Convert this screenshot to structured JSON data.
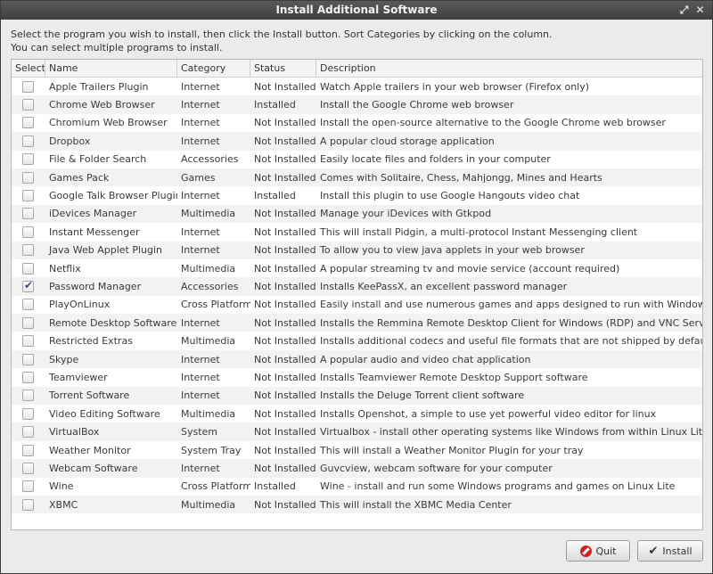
{
  "window": {
    "title": "Install Additional Software",
    "maximize_icon": "maximize-icon",
    "close_icon": "close-icon"
  },
  "instructions": {
    "line1": "Select the program you wish to install, then click the Install button. Sort Categories by clicking on the column.",
    "line2": "You can select multiple programs to install."
  },
  "table": {
    "headers": {
      "select": "Select",
      "name": "Name",
      "category": "Category",
      "status": "Status",
      "description": "Description"
    },
    "rows": [
      {
        "checked": false,
        "name": "Apple Trailers Plugin",
        "category": "Internet",
        "status": "Not Installed",
        "description": "Watch Apple trailers in your web browser (Firefox only)"
      },
      {
        "checked": false,
        "name": "Chrome Web Browser",
        "category": "Internet",
        "status": "Installed",
        "description": "Install the Google Chrome web browser"
      },
      {
        "checked": false,
        "name": "Chromium Web Browser",
        "category": "Internet",
        "status": "Not Installed",
        "description": "Install the open-source alternative to the Google Chrome web browser"
      },
      {
        "checked": false,
        "name": "Dropbox",
        "category": "Internet",
        "status": "Not Installed",
        "description": "A popular cloud storage application"
      },
      {
        "checked": false,
        "name": "File & Folder Search",
        "category": "Accessories",
        "status": "Not Installed",
        "description": "Easily locate files and folders in your computer"
      },
      {
        "checked": false,
        "name": "Games Pack",
        "category": "Games",
        "status": "Not Installed",
        "description": "Comes with Solitaire, Chess, Mahjongg, Mines and Hearts"
      },
      {
        "checked": false,
        "name": "Google Talk Browser Plugin",
        "category": "Internet",
        "status": "Installed",
        "description": "Install this plugin to use Google Hangouts video chat"
      },
      {
        "checked": false,
        "name": "iDevices Manager",
        "category": "Multimedia",
        "status": "Not Installed",
        "description": "Manage your iDevices with Gtkpod"
      },
      {
        "checked": false,
        "name": "Instant Messenger",
        "category": "Internet",
        "status": "Not Installed",
        "description": "This will install Pidgin, a multi-protocol Instant Messenging client"
      },
      {
        "checked": false,
        "name": "Java Web Applet Plugin",
        "category": "Internet",
        "status": "Not Installed",
        "description": "To allow you to view java applets in your web browser"
      },
      {
        "checked": false,
        "name": "Netflix",
        "category": "Multimedia",
        "status": "Not Installed",
        "description": "A popular streaming tv and movie service (account required)"
      },
      {
        "checked": true,
        "name": "Password Manager",
        "category": "Accessories",
        "status": "Not Installed",
        "description": "Installs KeePassX, an excellent password manager"
      },
      {
        "checked": false,
        "name": "PlayOnLinux",
        "category": "Cross Platform",
        "status": "Not Installed",
        "description": "Easily install and use numerous games and apps designed to run with Windows"
      },
      {
        "checked": false,
        "name": "Remote Desktop Software",
        "category": "Internet",
        "status": "Not Installed",
        "description": "Installs the Remmina Remote Desktop Client for Windows (RDP) and VNC Servers"
      },
      {
        "checked": false,
        "name": "Restricted Extras",
        "category": "Multimedia",
        "status": "Not Installed",
        "description": "Installs additional codecs and useful file formats that are not shipped by default"
      },
      {
        "checked": false,
        "name": "Skype",
        "category": "Internet",
        "status": "Not Installed",
        "description": "A popular audio and video chat application"
      },
      {
        "checked": false,
        "name": "Teamviewer",
        "category": "Internet",
        "status": "Not Installed",
        "description": "Installs Teamviewer Remote Desktop Support software"
      },
      {
        "checked": false,
        "name": "Torrent Software",
        "category": "Internet",
        "status": "Not Installed",
        "description": "Installs the Deluge Torrent client software"
      },
      {
        "checked": false,
        "name": "Video Editing Software",
        "category": "Multimedia",
        "status": "Not Installed",
        "description": "Installs Openshot, a simple to use yet powerful video editor for linux"
      },
      {
        "checked": false,
        "name": "VirtualBox",
        "category": "System",
        "status": "Not Installed",
        "description": "Virtualbox - install other operating systems like Windows from within Linux Lite"
      },
      {
        "checked": false,
        "name": "Weather Monitor",
        "category": "System Tray",
        "status": "Not Installed",
        "description": "This will install a Weather Monitor Plugin for your tray"
      },
      {
        "checked": false,
        "name": "Webcam Software",
        "category": "Internet",
        "status": "Not Installed",
        "description": "Guvcview, webcam software for your computer"
      },
      {
        "checked": false,
        "name": "Wine",
        "category": "Cross Platform",
        "status": "Installed",
        "description": "Wine - install and run some Windows programs and games on Linux Lite"
      },
      {
        "checked": false,
        "name": "XBMC",
        "category": "Multimedia",
        "status": "Not Installed",
        "description": "This will install the XBMC Media Center"
      }
    ]
  },
  "buttons": {
    "quit": "Quit",
    "install": "Install",
    "quit_icon": "stop-icon",
    "install_icon": "checkmark-icon"
  }
}
